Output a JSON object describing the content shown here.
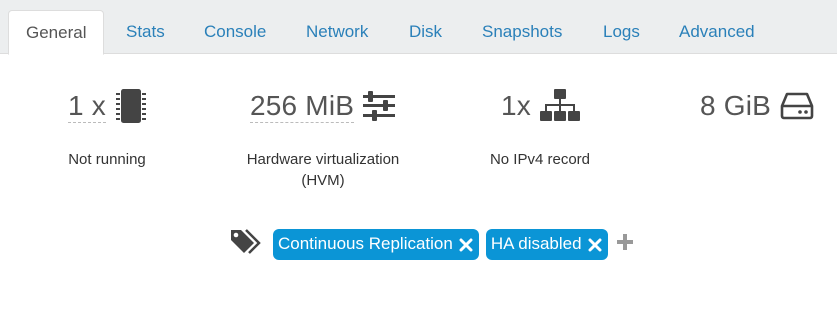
{
  "tabs": [
    {
      "label": "General",
      "active": true
    },
    {
      "label": "Stats"
    },
    {
      "label": "Console"
    },
    {
      "label": "Network"
    },
    {
      "label": "Disk"
    },
    {
      "label": "Snapshots"
    },
    {
      "label": "Logs"
    },
    {
      "label": "Advanced"
    }
  ],
  "cpu": {
    "value": "1 x",
    "icon": "cpu-chip-icon",
    "caption": "Not running"
  },
  "memory": {
    "value": "256 MiB",
    "icon": "sliders-icon",
    "caption_line1": "Hardware virtualization",
    "caption_line2": "(HVM)"
  },
  "network": {
    "value": "1x",
    "icon": "network-tree-icon",
    "caption": "No IPv4 record"
  },
  "disk": {
    "value": "8 GiB",
    "icon": "hard-drive-icon"
  },
  "tags": {
    "icon": "tags-icon",
    "items": [
      "Continuous Replication",
      "HA disabled"
    ],
    "add_icon": "plus-icon"
  },
  "colors": {
    "tag_bg": "#0b95d6",
    "tab_link": "#2a80b9",
    "icon": "#444444",
    "add_icon": "#999999"
  }
}
